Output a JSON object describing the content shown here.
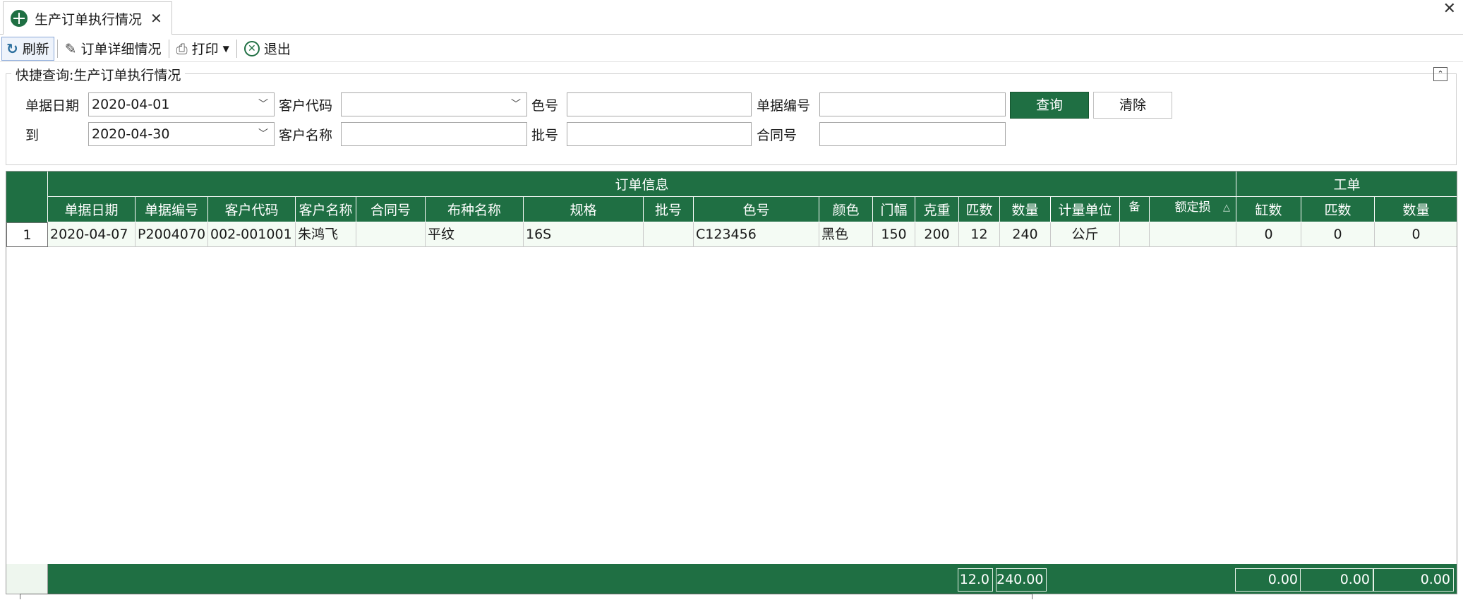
{
  "tab": {
    "title": "生产订单执行情况",
    "close": "✕"
  },
  "window": {
    "close": "✕"
  },
  "toolbar": {
    "refresh": "刷新",
    "order_detail": "订单详细情况",
    "print": "打印",
    "exit": "退出"
  },
  "query": {
    "title": "快捷查询:生产订单执行情况",
    "date_label": "单据日期",
    "date_from": "2020-04-01",
    "to_label": "到",
    "date_to": "2020-04-30",
    "customer_code_label": "客户代码",
    "customer_code": "",
    "customer_name_label": "客户名称",
    "customer_name": "",
    "color_no_label": "色号",
    "color_no": "",
    "batch_label": "批号",
    "batch": "",
    "doc_no_label": "单据编号",
    "doc_no": "",
    "contract_label": "合同号",
    "contract": "",
    "query_button": "查询",
    "clear_button": "清除"
  },
  "grid": {
    "group_order": "订单信息",
    "group_work": "工单",
    "columns": [
      "单据日期",
      "单据编号",
      "客户代码",
      "客户名称",
      "合同号",
      "布种名称",
      "规格",
      "批号",
      "色号",
      "颜色",
      "门幅",
      "克重",
      "匹数",
      "数量",
      "计量单位",
      "备",
      "额定损"
    ],
    "work_columns": [
      "缸数",
      "匹数",
      "数量"
    ],
    "rows": [
      {
        "num": "1",
        "date": "2020-04-07",
        "doc_no": "P2004070",
        "customer_code": "002-001001",
        "customer_name": "朱鸿飞",
        "contract": "",
        "fabric": "平纹",
        "spec": "16S",
        "batch": "",
        "color_no": "C123456",
        "color": "黑色",
        "width": "150",
        "weight": "200",
        "pieces": "12",
        "qty": "240",
        "unit": "公斤",
        "remark": "",
        "loss": "",
        "vats": "0",
        "work_pieces": "0",
        "work_qty": "0"
      }
    ],
    "totals": {
      "pieces": "12.0",
      "qty": "240.00",
      "vats": "0.00",
      "work_pieces": "0.00",
      "work_qty": "0.00"
    }
  }
}
